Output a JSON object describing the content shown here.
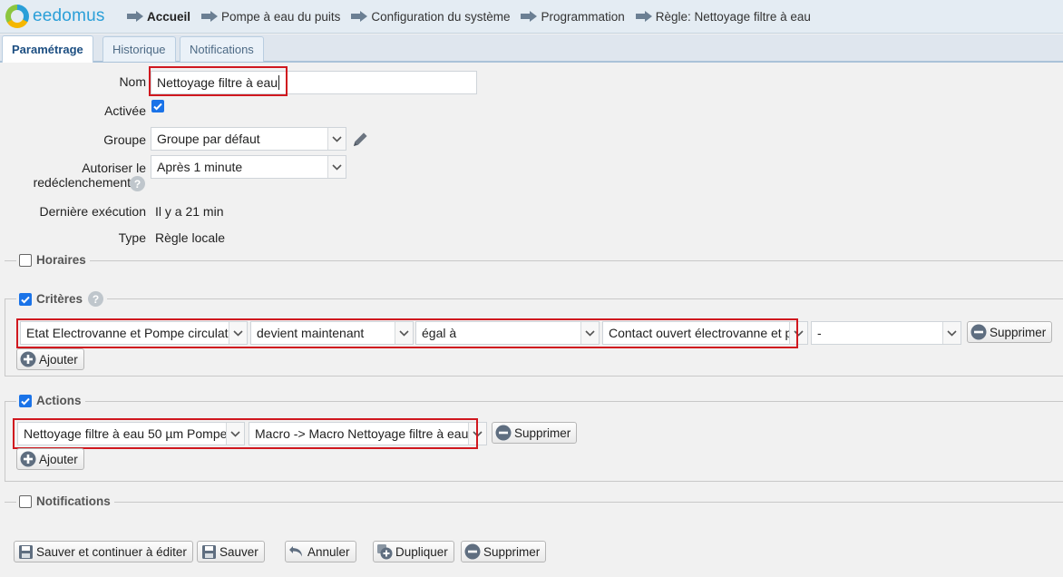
{
  "app": {
    "logo_text": "eedomus"
  },
  "breadcrumb": [
    {
      "label": "Accueil"
    },
    {
      "label": "Pompe à eau du puits"
    },
    {
      "label": "Configuration du système"
    },
    {
      "label": "Programmation"
    },
    {
      "label": "Règle: Nettoyage filtre à eau"
    }
  ],
  "tabs": [
    {
      "label": "Paramétrage",
      "active": true
    },
    {
      "label": "Historique"
    },
    {
      "label": "Notifications"
    }
  ],
  "form": {
    "nom_label": "Nom",
    "nom_value": "Nettoyage filtre à eau",
    "activee_label": "Activée",
    "activee_checked": true,
    "groupe_label": "Groupe",
    "groupe_value": "Groupe par défaut",
    "autoriser_label_1": "Autoriser le",
    "autoriser_label_2": "redéclenchement",
    "autoriser_value": "Après 1 minute",
    "derniere_label": "Dernière exécution",
    "derniere_value": "Il y a 21 min",
    "type_label": "Type",
    "type_value": "Règle locale"
  },
  "sections": {
    "horaires": {
      "label": "Horaires",
      "checked": false
    },
    "criteres": {
      "label": "Critères",
      "checked": true,
      "row": {
        "device": "Etat Electrovanne et Pompe circulateur",
        "mode": "devient maintenant",
        "operator": "égal à",
        "value": "Contact ouvert électrovanne et pompe",
        "extra": "-",
        "delete_label": "Supprimer"
      },
      "add_label": "Ajouter"
    },
    "actions": {
      "label": "Actions",
      "checked": true,
      "row": {
        "device": "Nettoyage filtre à eau 50 µm Pompe",
        "action": "Macro -> Macro Nettoyage filtre à eau",
        "delete_label": "Supprimer"
      },
      "add_label": "Ajouter"
    },
    "notifications": {
      "label": "Notifications",
      "checked": false
    }
  },
  "footer": {
    "save_continue": "Sauver et continuer à éditer",
    "save": "Sauver",
    "cancel": "Annuler",
    "duplicate": "Dupliquer",
    "delete": "Supprimer"
  },
  "colors": {
    "accent_blue": "#1a73e8",
    "highlight_red": "#d0181f",
    "logo_blue": "#2a9fd8"
  }
}
